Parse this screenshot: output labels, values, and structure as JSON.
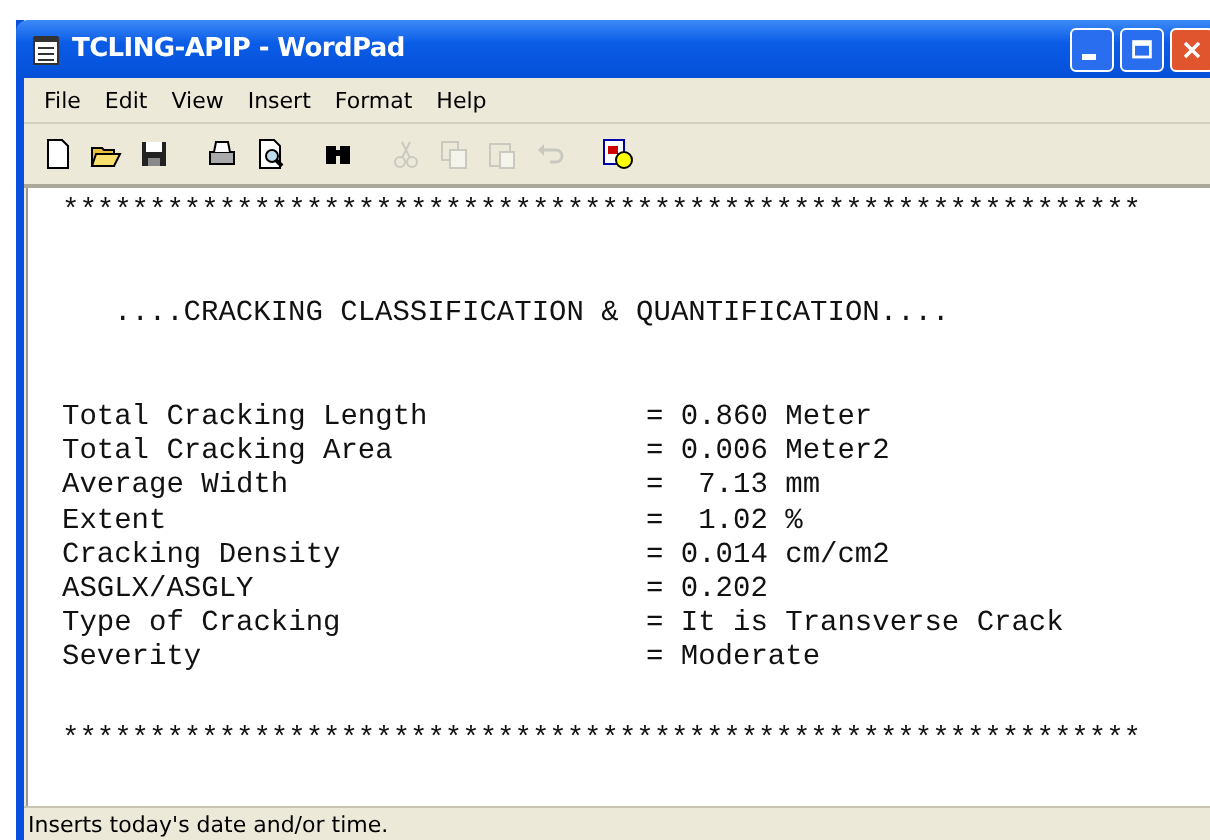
{
  "window": {
    "title": "TCLING-APIP - WordPad"
  },
  "menu": [
    "File",
    "Edit",
    "View",
    "Insert",
    "Format",
    "Help"
  ],
  "toolbar": [
    {
      "kind": "new",
      "disabled": false
    },
    {
      "kind": "open",
      "disabled": false
    },
    {
      "kind": "save",
      "disabled": false
    },
    {
      "kind": "sep"
    },
    {
      "kind": "print",
      "disabled": false
    },
    {
      "kind": "preview",
      "disabled": false
    },
    {
      "kind": "sep"
    },
    {
      "kind": "find",
      "disabled": false
    },
    {
      "kind": "sep"
    },
    {
      "kind": "cut",
      "disabled": true
    },
    {
      "kind": "copy",
      "disabled": true
    },
    {
      "kind": "paste",
      "disabled": true
    },
    {
      "kind": "undo",
      "disabled": true
    },
    {
      "kind": "sep"
    },
    {
      "kind": "datetime",
      "disabled": false
    }
  ],
  "document": {
    "rule_top": "**************************************************************",
    "heading": "....CRACKING CLASSIFICATION & QUANTIFICATION....",
    "rows": [
      {
        "label": "Total Cracking Length",
        "value": "= 0.860 Meter"
      },
      {
        "label": "Total Cracking Area",
        "value": "= 0.006 Meter2"
      },
      {
        "label": "Average Width",
        "value": "=  7.13 mm"
      },
      {
        "label": "Extent",
        "value": "=  1.02 %"
      },
      {
        "label": "Cracking Density",
        "value": "= 0.014 cm/cm2"
      },
      {
        "label": "ASGLX/ASGLY",
        "value": "= 0.202"
      },
      {
        "label": "Type of Cracking",
        "value": "= It is Transverse Crack"
      },
      {
        "label": "Severity",
        "value": "= Moderate"
      }
    ],
    "rule_bottom": "**************************************************************"
  },
  "status_bar": "Inserts today's date and/or time."
}
